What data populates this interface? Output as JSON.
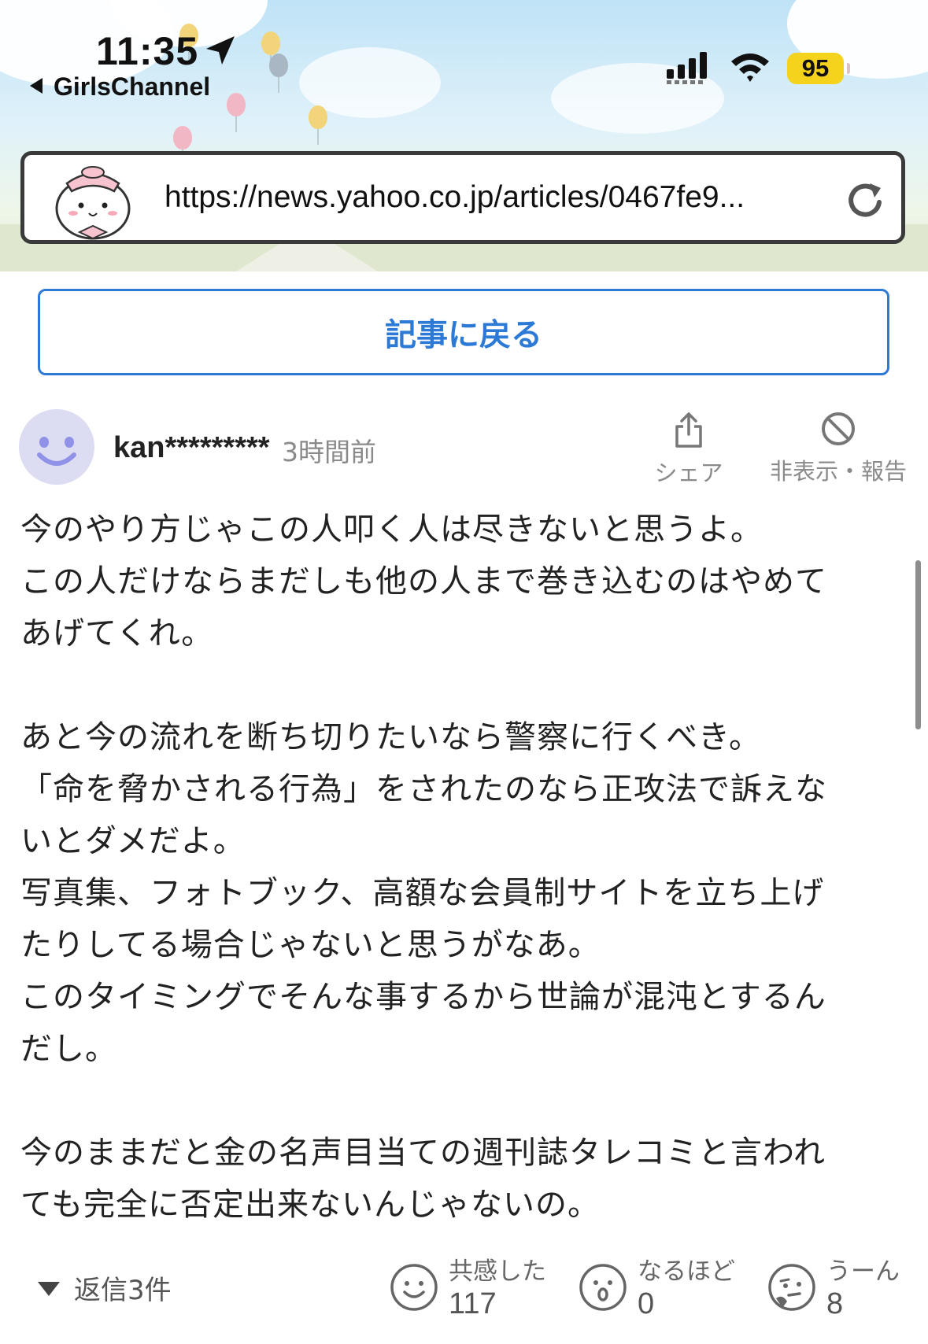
{
  "status_bar": {
    "time": "11:35",
    "back_app": "GirlsChannel",
    "battery": "95"
  },
  "browser": {
    "url": "https://news.yahoo.co.jp/articles/0467fe9..."
  },
  "back_button": {
    "label": "記事に戻る"
  },
  "comment": {
    "username": "kan*********",
    "time_ago": "3時間前",
    "share_label": "シェア",
    "hide_label": "非表示・報告",
    "paragraphs": [
      [
        "今のやり方じゃこの人叩く人は尽きないと思うよ。",
        "この人だけならまだしも他の人まで巻き込むのはやめて",
        "あげてくれ。"
      ],
      [
        "あと今の流れを断ち切りたいなら警察に行くべき。",
        "「命を脅かされる行為」をされたのなら正攻法で訴えな",
        "いとダメだよ。",
        "写真集、フォトブック、高額な会員制サイトを立ち上げ",
        "たりしてる場合じゃないと思うがなあ。",
        "このタイミングでそんな事するから世論が混沌とするん",
        "だし。"
      ],
      [
        "今のままだと金の名声目当ての週刊誌タレコミと言われ",
        "ても完全に否定出来ないんじゃないの。"
      ]
    ],
    "replies_label": "返信3件",
    "reactions": [
      {
        "label": "共感した",
        "count": "117",
        "icon": "smile-face-icon"
      },
      {
        "label": "なるほど",
        "count": "0",
        "icon": "surprised-face-icon"
      },
      {
        "label": "うーん",
        "count": "8",
        "icon": "thinking-face-icon"
      }
    ]
  },
  "colors": {
    "accent_blue": "#2c7ad6",
    "battery_yellow": "#f5d21c",
    "avatar_purple": "#dcdcf3",
    "muted_gray": "#8a8a8a"
  }
}
